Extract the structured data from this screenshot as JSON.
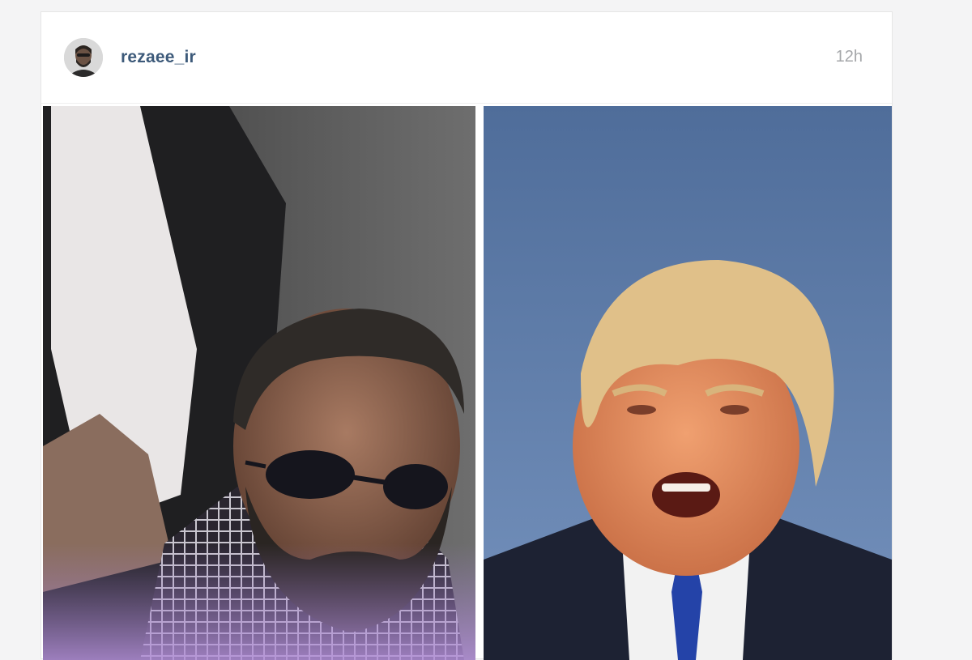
{
  "post": {
    "username": "rezaee_ir",
    "timestamp": "12h",
    "avatar_icon": "user-avatar-photo",
    "images": [
      {
        "name": "left-portrait-photo",
        "description_icon": "photo-icon"
      },
      {
        "name": "right-portrait-photo",
        "description_icon": "photo-icon"
      }
    ]
  },
  "colors": {
    "username": "#3d5a7a",
    "timestamp": "#a5a7aa",
    "card_border": "#e6e6e6",
    "page_bg": "#f4f4f5"
  }
}
